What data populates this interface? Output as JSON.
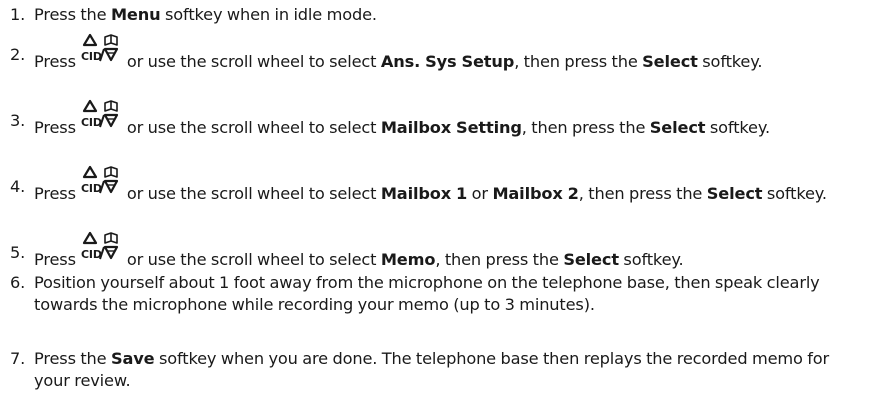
{
  "steps": [
    {
      "number": "1.",
      "text_a": "Press the ",
      "bold_a": "Menu",
      "text_b": " softkey when in idle mode."
    },
    {
      "number": "2.",
      "lead": "Press ",
      "key_label": "CID",
      "text_a": " or use the scroll wheel to select ",
      "bold_a": "Ans. Sys Setup",
      "text_b": ", then press the ",
      "bold_b": "Select",
      "text_c": " softkey."
    },
    {
      "number": "3.",
      "lead": "Press ",
      "key_label": "CID",
      "text_a": " or use the scroll wheel to select ",
      "bold_a": "Mailbox Setting",
      "text_b": ", then press the ",
      "bold_b": "Select",
      "text_c": " softkey."
    },
    {
      "number": "4.",
      "lead": "Press ",
      "key_label": "CID",
      "text_a": " or use the scroll wheel to select ",
      "bold_a": "Mailbox 1",
      "text_b": " or ",
      "bold_b": "Mailbox 2",
      "text_c": ", then press the ",
      "bold_c": "Select",
      "text_d": " softkey."
    },
    {
      "number": "5.",
      "lead": "Press ",
      "key_label": "CID",
      "text_a": " or use the scroll wheel to select ",
      "bold_a": "Memo",
      "text_b": ", then press the ",
      "bold_b": "Select",
      "text_c": " softkey."
    },
    {
      "number": "6.",
      "text_a": "Position yourself about 1 foot away from the microphone on the telephone base, then speak clearly towards the microphone while recording your memo (up to 3 minutes)."
    },
    {
      "number": "7.",
      "text_a": "Press the ",
      "bold_a": "Save",
      "text_b": " softkey when you are done. The telephone base then replays the recorded memo for your review."
    }
  ],
  "icons": {
    "scroll_key": "up-down-cid-phonebook-key-icon"
  }
}
